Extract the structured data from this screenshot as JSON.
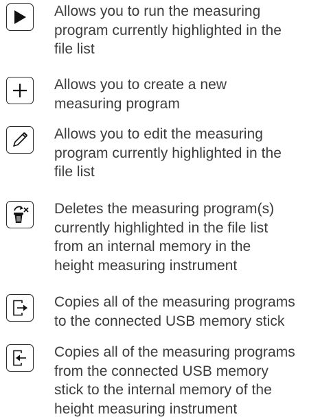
{
  "functions": [
    {
      "icon": "play-icon",
      "description_lines": [
        "Allows you to run the measuring",
        "program currently highlighted in the",
        "file list"
      ]
    },
    {
      "icon": "plus-icon",
      "description_lines": [
        "Allows you to create a new",
        "measuring program"
      ]
    },
    {
      "icon": "pencil-icon",
      "description_lines": [
        "Allows you to edit the measuring",
        "program currently highlighted in the",
        "file list"
      ]
    },
    {
      "icon": "trash-icon",
      "description_lines": [
        "Deletes the measuring program(s)",
        "currently highlighted in the file list",
        "from an internal memory in the",
        "height measuring instrument"
      ]
    },
    {
      "icon": "export-icon",
      "description_lines": [
        "Copies all of the measuring programs",
        "to the connected USB memory stick"
      ]
    },
    {
      "icon": "import-icon",
      "description_lines": [
        "Copies all of the measuring programs",
        "from the connected USB memory",
        "stick to the internal memory of the",
        "height measuring instrument"
      ]
    }
  ]
}
